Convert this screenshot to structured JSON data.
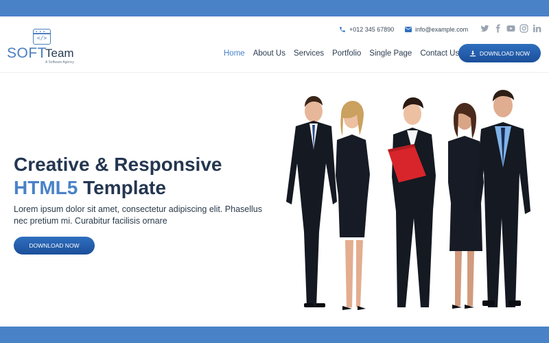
{
  "brand": {
    "name_part1": "SOFT",
    "name_part2": "Team",
    "tagline": "A Software Agency",
    "mark_code": "</>",
    "accent_color": "#4a82c8",
    "dark_color": "#243650"
  },
  "contact": {
    "phone": "+012 345 67890",
    "email": "info@example.com"
  },
  "social": [
    "twitter-icon",
    "facebook-icon",
    "youtube-icon",
    "instagram-icon",
    "linkedin-icon"
  ],
  "nav": {
    "items": [
      {
        "label": "Home",
        "active": true
      },
      {
        "label": "About Us"
      },
      {
        "label": "Services"
      },
      {
        "label": "Portfolio"
      },
      {
        "label": "Single Page"
      },
      {
        "label": "Contact Us"
      }
    ],
    "download_label": "DOWNLOAD NOW"
  },
  "hero": {
    "title_line1": "Creative & Responsive",
    "title_accent": "HTML5",
    "title_rest": "Template",
    "description": "Lorem ipsum dolor sit amet, consectetur adipiscing elit. Phasellus nec pretium mi. Curabitur facilisis ornare",
    "button_label": "DOWNLOAD NOW"
  }
}
